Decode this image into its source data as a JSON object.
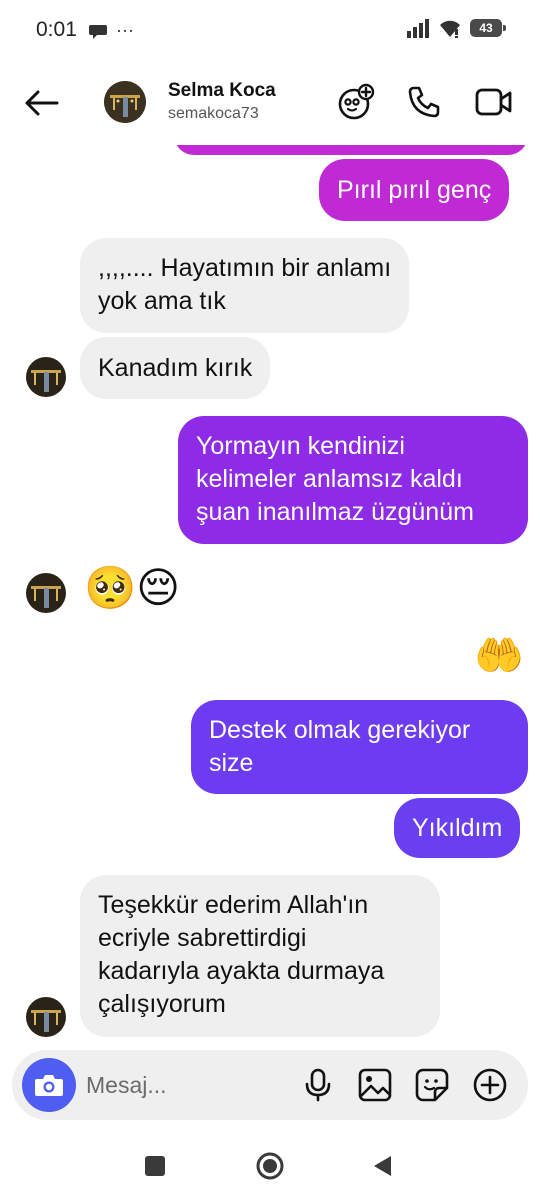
{
  "status_bar": {
    "time": "0:01",
    "more": "···",
    "battery": "43"
  },
  "header": {
    "name": "Selma Koca",
    "username": "semakoca73"
  },
  "messages": [
    {
      "side": "out",
      "text": "Pırıl pırıl genç"
    },
    {
      "side": "in",
      "lines": [
        ",,,,.... Hayatımın bir anlamı",
        "yok ama tık"
      ]
    },
    {
      "side": "in",
      "text": "Kanadım kırık"
    },
    {
      "side": "out",
      "lines": [
        "Yormayın kendinizi",
        "kelimeler anlamsız kaldı",
        "şuan inanılmaz üzgünüm"
      ]
    },
    {
      "side": "in",
      "emoji": "🥺😔"
    },
    {
      "side": "out",
      "emoji": "🤲"
    },
    {
      "side": "out",
      "lines": [
        "Destek olmak gerekiyor",
        "size"
      ]
    },
    {
      "side": "out",
      "text": "Yıkıldım"
    },
    {
      "side": "in",
      "lines": [
        "Teşekkür ederim Allah'ın",
        "ecriyle sabrettirdigi",
        "kadarıyla ayakta durmaya",
        "çalışıyorum"
      ]
    }
  ],
  "composer": {
    "placeholder": "Mesaj..."
  },
  "colors": {
    "bubble_pink": "#b72ad8",
    "bubble_purple": "#8b2ee8",
    "bubble_violet": "#6b3ff0",
    "incoming_bg": "#efefef",
    "camera_blue": "#4f5df0"
  },
  "icons": [
    "back-arrow-icon",
    "add-friend-face-icon",
    "phone-icon",
    "video-camera-icon",
    "camera-icon",
    "microphone-icon",
    "image-icon",
    "sticker-icon",
    "plus-circle-icon"
  ]
}
